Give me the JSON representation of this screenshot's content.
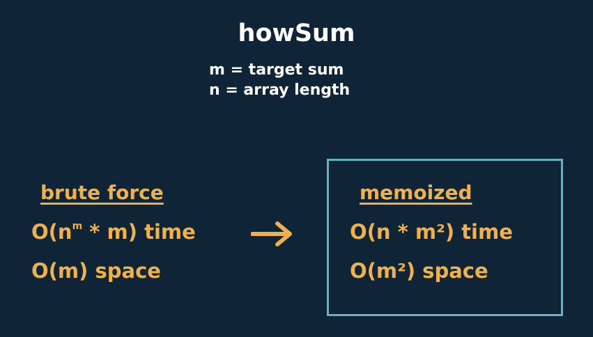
{
  "title": "howSum",
  "definitions": {
    "m": "m = target sum",
    "n": "n = array length"
  },
  "brute_force": {
    "heading": "brute force",
    "time_prefix": "O(n",
    "time_exponent": "m",
    "time_suffix": " * m) time",
    "space": "O(m) space"
  },
  "memoized": {
    "heading": "memoized",
    "time": "O(n * m²) time",
    "space": "O(m²) space"
  },
  "icons": {
    "arrow": "right-arrow-icon"
  },
  "colors": {
    "background": "#0f2537",
    "text_white": "#ffffff",
    "accent_orange": "#eeb14c",
    "box_teal": "#5fb6c2"
  }
}
